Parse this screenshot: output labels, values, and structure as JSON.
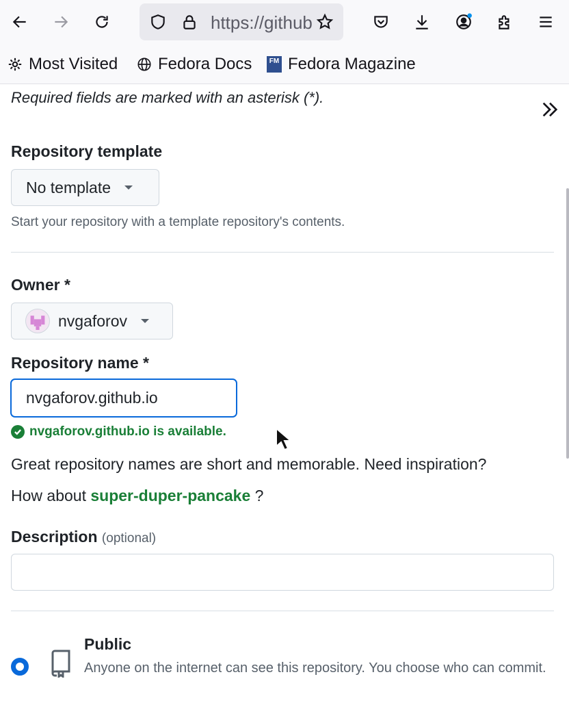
{
  "browser": {
    "url_text": "https://github.com/new",
    "bookmarks": [
      {
        "label": "Most Visited",
        "icon": "gear-icon"
      },
      {
        "label": "Fedora Docs",
        "icon": "globe-icon"
      },
      {
        "label": "Fedora Magazine",
        "icon": "fedora-magazine-icon",
        "icon_text": "FM"
      }
    ]
  },
  "form": {
    "required_note": "Required fields are marked with an asterisk (*).",
    "template": {
      "label": "Repository template",
      "selected": "No template",
      "hint": "Start your repository with a template repository's contents."
    },
    "owner": {
      "label": "Owner *",
      "selected": "nvgaforov"
    },
    "repo_name": {
      "label": "Repository name *",
      "value": "nvgaforov.github.io",
      "availability": "nvgaforov.github.io is available."
    },
    "inspiration": {
      "line1": "Great repository names are short and memorable. Need inspiration?",
      "line2_prefix": "How about",
      "suggestion": "super-duper-pancake",
      "line2_suffix": "?"
    },
    "description": {
      "label": "Description",
      "optional": "(optional)",
      "value": ""
    },
    "visibility": {
      "title": "Public",
      "desc": "Anyone on the internet can see this repository. You choose who can commit.",
      "selected": true
    }
  },
  "colors": {
    "accent": "#0969da",
    "success": "#1a7f37"
  }
}
